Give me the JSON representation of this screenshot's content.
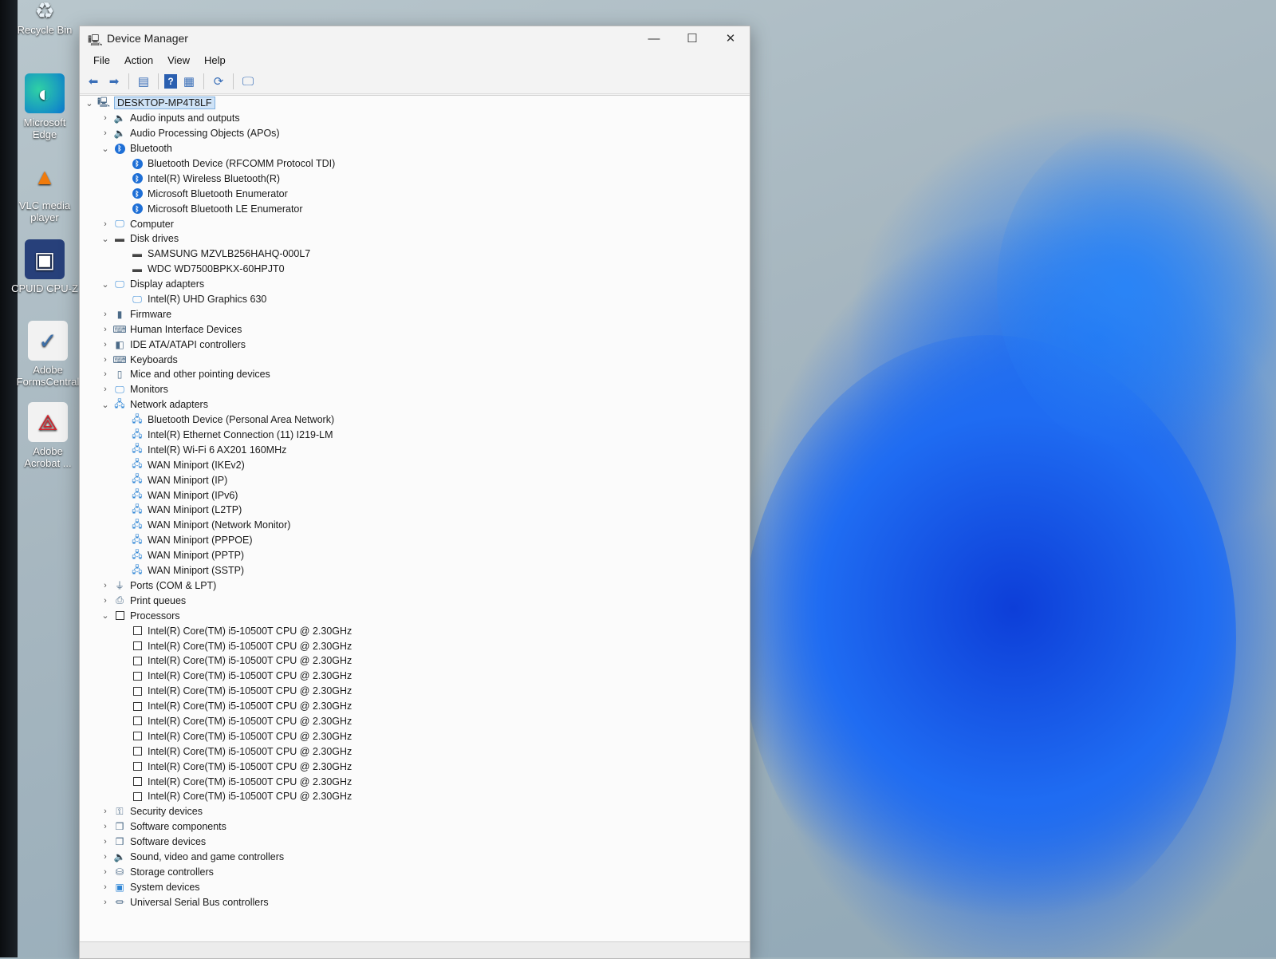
{
  "desktop": {
    "icons": [
      {
        "label": "Recycle Bin",
        "icon": "recycle-bin-icon"
      },
      {
        "label": "Microsoft Edge",
        "icon": "edge-icon"
      },
      {
        "label": "VLC media player",
        "icon": "vlc-icon"
      },
      {
        "label": "CPUID CPU-Z",
        "icon": "cpuz-icon"
      },
      {
        "label": "Adobe FormsCentral",
        "icon": "formscentral-icon"
      },
      {
        "label": "Adobe Acrobat ...",
        "icon": "acrobat-icon"
      }
    ]
  },
  "window": {
    "title": "Device Manager",
    "controls": {
      "minimize": "—",
      "maximize": "☐",
      "close": "✕"
    },
    "menu": [
      "File",
      "Action",
      "View",
      "Help"
    ]
  },
  "tree": {
    "root": "DESKTOP-MP4T8LF",
    "nodes": [
      {
        "label": "Audio inputs and outputs",
        "level": 1,
        "state": "collapsed",
        "icon": "speaker-icon"
      },
      {
        "label": "Audio Processing Objects (APOs)",
        "level": 1,
        "state": "collapsed",
        "icon": "speaker-icon"
      },
      {
        "label": "Bluetooth",
        "level": 1,
        "state": "expanded",
        "icon": "bluetooth-icon"
      },
      {
        "label": "Bluetooth Device (RFCOMM Protocol TDI)",
        "level": 2,
        "icon": "bluetooth-icon"
      },
      {
        "label": "Intel(R) Wireless Bluetooth(R)",
        "level": 2,
        "icon": "bluetooth-icon"
      },
      {
        "label": "Microsoft Bluetooth Enumerator",
        "level": 2,
        "icon": "bluetooth-icon"
      },
      {
        "label": "Microsoft Bluetooth LE Enumerator",
        "level": 2,
        "icon": "bluetooth-icon"
      },
      {
        "label": "Computer",
        "level": 1,
        "state": "collapsed",
        "icon": "monitor-icon"
      },
      {
        "label": "Disk drives",
        "level": 1,
        "state": "expanded",
        "icon": "disk-icon"
      },
      {
        "label": "SAMSUNG MZVLB256HAHQ-000L7",
        "level": 2,
        "icon": "disk-icon"
      },
      {
        "label": "WDC WD7500BPKX-60HPJT0",
        "level": 2,
        "icon": "disk-icon"
      },
      {
        "label": "Display adapters",
        "level": 1,
        "state": "expanded",
        "icon": "monitor-icon"
      },
      {
        "label": "Intel(R) UHD Graphics 630",
        "level": 2,
        "icon": "monitor-icon"
      },
      {
        "label": "Firmware",
        "level": 1,
        "state": "collapsed",
        "icon": "chip-icon"
      },
      {
        "label": "Human Interface Devices",
        "level": 1,
        "state": "collapsed",
        "icon": "hid-icon"
      },
      {
        "label": "IDE ATA/ATAPI controllers",
        "level": 1,
        "state": "collapsed",
        "icon": "controller-icon"
      },
      {
        "label": "Keyboards",
        "level": 1,
        "state": "collapsed",
        "icon": "keyboard-icon"
      },
      {
        "label": "Mice and other pointing devices",
        "level": 1,
        "state": "collapsed",
        "icon": "mouse-icon"
      },
      {
        "label": "Monitors",
        "level": 1,
        "state": "collapsed",
        "icon": "monitor-icon"
      },
      {
        "label": "Network adapters",
        "level": 1,
        "state": "expanded",
        "icon": "network-icon"
      },
      {
        "label": "Bluetooth Device (Personal Area Network)",
        "level": 2,
        "icon": "network-icon"
      },
      {
        "label": "Intel(R) Ethernet Connection (11) I219-LM",
        "level": 2,
        "icon": "network-icon"
      },
      {
        "label": "Intel(R) Wi-Fi 6 AX201 160MHz",
        "level": 2,
        "icon": "network-icon"
      },
      {
        "label": "WAN Miniport (IKEv2)",
        "level": 2,
        "icon": "network-icon"
      },
      {
        "label": "WAN Miniport (IP)",
        "level": 2,
        "icon": "network-icon"
      },
      {
        "label": "WAN Miniport (IPv6)",
        "level": 2,
        "icon": "network-icon"
      },
      {
        "label": "WAN Miniport (L2TP)",
        "level": 2,
        "icon": "network-icon"
      },
      {
        "label": "WAN Miniport (Network Monitor)",
        "level": 2,
        "icon": "network-icon"
      },
      {
        "label": "WAN Miniport (PPPOE)",
        "level": 2,
        "icon": "network-icon"
      },
      {
        "label": "WAN Miniport (PPTP)",
        "level": 2,
        "icon": "network-icon"
      },
      {
        "label": "WAN Miniport (SSTP)",
        "level": 2,
        "icon": "network-icon"
      },
      {
        "label": "Ports (COM & LPT)",
        "level": 1,
        "state": "collapsed",
        "icon": "port-icon"
      },
      {
        "label": "Print queues",
        "level": 1,
        "state": "collapsed",
        "icon": "printer-icon"
      },
      {
        "label": "Processors",
        "level": 1,
        "state": "expanded",
        "icon": "processor-icon"
      },
      {
        "label": "Intel(R) Core(TM) i5-10500T CPU @ 2.30GHz",
        "level": 2,
        "icon": "processor-icon"
      },
      {
        "label": "Intel(R) Core(TM) i5-10500T CPU @ 2.30GHz",
        "level": 2,
        "icon": "processor-icon"
      },
      {
        "label": "Intel(R) Core(TM) i5-10500T CPU @ 2.30GHz",
        "level": 2,
        "icon": "processor-icon"
      },
      {
        "label": "Intel(R) Core(TM) i5-10500T CPU @ 2.30GHz",
        "level": 2,
        "icon": "processor-icon"
      },
      {
        "label": "Intel(R) Core(TM) i5-10500T CPU @ 2.30GHz",
        "level": 2,
        "icon": "processor-icon"
      },
      {
        "label": "Intel(R) Core(TM) i5-10500T CPU @ 2.30GHz",
        "level": 2,
        "icon": "processor-icon"
      },
      {
        "label": "Intel(R) Core(TM) i5-10500T CPU @ 2.30GHz",
        "level": 2,
        "icon": "processor-icon"
      },
      {
        "label": "Intel(R) Core(TM) i5-10500T CPU @ 2.30GHz",
        "level": 2,
        "icon": "processor-icon"
      },
      {
        "label": "Intel(R) Core(TM) i5-10500T CPU @ 2.30GHz",
        "level": 2,
        "icon": "processor-icon"
      },
      {
        "label": "Intel(R) Core(TM) i5-10500T CPU @ 2.30GHz",
        "level": 2,
        "icon": "processor-icon"
      },
      {
        "label": "Intel(R) Core(TM) i5-10500T CPU @ 2.30GHz",
        "level": 2,
        "icon": "processor-icon"
      },
      {
        "label": "Intel(R) Core(TM) i5-10500T CPU @ 2.30GHz",
        "level": 2,
        "icon": "processor-icon"
      },
      {
        "label": "Security devices",
        "level": 1,
        "state": "collapsed",
        "icon": "security-icon"
      },
      {
        "label": "Software components",
        "level": 1,
        "state": "collapsed",
        "icon": "component-icon"
      },
      {
        "label": "Software devices",
        "level": 1,
        "state": "collapsed",
        "icon": "component-icon"
      },
      {
        "label": "Sound, video and game controllers",
        "level": 1,
        "state": "collapsed",
        "icon": "speaker-icon"
      },
      {
        "label": "Storage controllers",
        "level": 1,
        "state": "collapsed",
        "icon": "storage-icon"
      },
      {
        "label": "System devices",
        "level": 1,
        "state": "collapsed",
        "icon": "system-icon"
      },
      {
        "label": "Universal Serial Bus controllers",
        "level": 1,
        "state": "collapsed",
        "icon": "usb-icon"
      }
    ]
  }
}
